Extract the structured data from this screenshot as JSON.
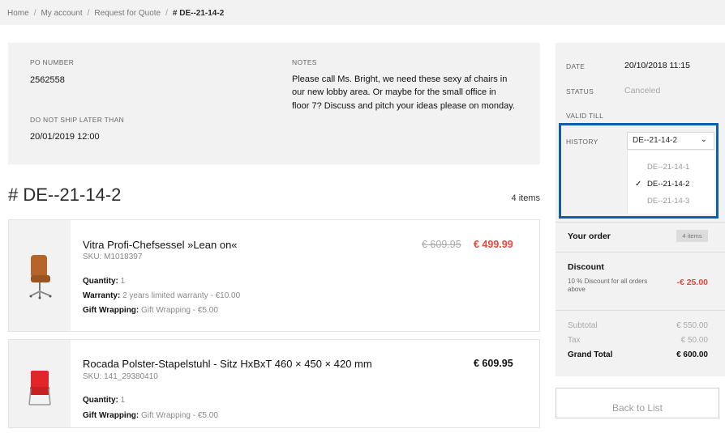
{
  "breadcrumb": {
    "items": [
      "Home",
      "My account",
      "Request for Quote"
    ],
    "current": "# DE--21-14-2"
  },
  "info": {
    "po_label": "PO NUMBER",
    "po_value": "2562558",
    "noship_label": "DO NOT SHIP LATER THAN",
    "noship_value": "20/01/2019 12:00",
    "notes_label": "NOTES",
    "notes_value": "Please call Ms. Bright, we need these sexy af chairs in our new lobby area. Or maybe for the small office in floor 7? Discuss and pitch your ideas please on monday."
  },
  "quote": {
    "title": "# DE--21-14-2",
    "items_count": "4 items"
  },
  "products": [
    {
      "name": "Vitra Profi-Chefsessel »Lean on«",
      "sku": "SKU: M1018397",
      "price_old": "€ 609.95",
      "price_new": "€ 499.99",
      "options": [
        {
          "label": "Quantity:",
          "value": "1"
        },
        {
          "label": "Warranty:",
          "value": "2 years limited warranty - €10.00"
        },
        {
          "label": "Gift Wrapping:",
          "value": "Gift Wrapping - €5.00"
        }
      ]
    },
    {
      "name": "Rocada Polster-Stapelstuhl - Sitz HxBxT 460 × 450 × 420 mm",
      "sku": "SKU: 141_29380410",
      "price": "€ 609.95",
      "options": [
        {
          "label": "Quantity:",
          "value": "1"
        },
        {
          "label": "Gift Wrapping:",
          "value": "Gift Wrapping - €5.00"
        }
      ]
    }
  ],
  "sidebar": {
    "date_label": "DATE",
    "date_value": "20/10/2018 11:15",
    "status_label": "STATUS",
    "status_value": "Canceled",
    "valid_label": "VALID TILL",
    "history_label": "HISTORY",
    "history_selected": "DE--21-14-2",
    "history_options": [
      "DE--21-14-1",
      "DE--21-14-2",
      "DE--21-14-3"
    ]
  },
  "order": {
    "title": "Your order",
    "badge": "4 items",
    "discount_title": "Discount",
    "discount_desc": "10 % Discount for all orders above",
    "discount_amount": "-€ 25.00",
    "subtotal_label": "Subtotal",
    "subtotal_value": "€ 550.00",
    "tax_label": "Tax",
    "tax_value": "€ 50.00",
    "grand_label": "Grand Total",
    "grand_value": "€ 600.00"
  },
  "back_button": "Back to List",
  "colors": {
    "accent_red": "#e8473c",
    "highlight_blue": "#0e5ea8",
    "panel_gray": "#f2f2f2"
  }
}
